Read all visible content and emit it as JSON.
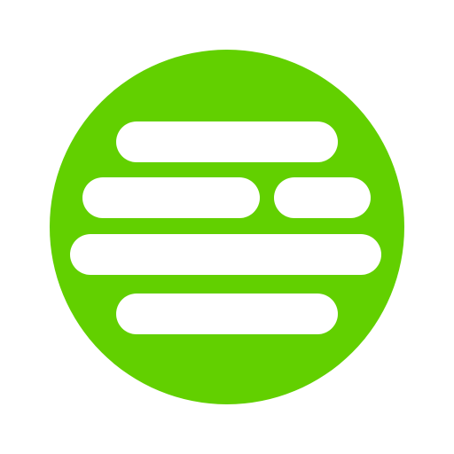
{
  "icon": {
    "name": "green-circle-text-lines-icon",
    "shape": "circle",
    "glyph": "horizontal-text-lines"
  },
  "colors": {
    "background": "#ffffff",
    "circle": "#62d000",
    "lines": "#ffffff"
  }
}
